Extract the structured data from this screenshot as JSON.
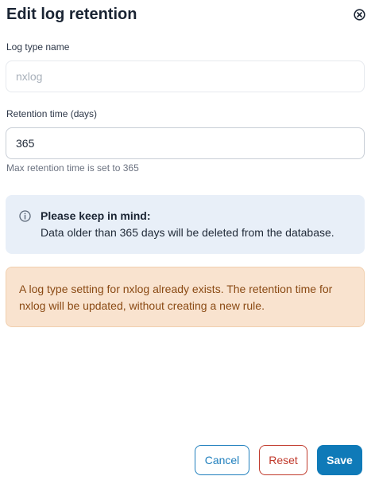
{
  "dialog": {
    "title": "Edit log retention",
    "close_icon": "close-circle-icon"
  },
  "form": {
    "log_type": {
      "label": "Log type name",
      "value": "nxlog"
    },
    "retention": {
      "label": "Retention time (days)",
      "value": "365",
      "helper": "Max retention time is set to 365"
    }
  },
  "info_notice": {
    "icon": "info-icon",
    "title": "Please keep in mind:",
    "text": "Data older than 365 days will be deleted from the database."
  },
  "warning_notice": {
    "text": "A log type setting for nxlog already exists. The retention time for nxlog will be updated, without creating a new rule."
  },
  "actions": {
    "cancel_label": "Cancel",
    "reset_label": "Reset",
    "save_label": "Save"
  },
  "colors": {
    "primary": "#0f7ab8",
    "danger": "#c0392b",
    "info_bg": "#e8eff8",
    "warning_bg": "#f9e3cf",
    "warning_text": "#8a4a14"
  }
}
